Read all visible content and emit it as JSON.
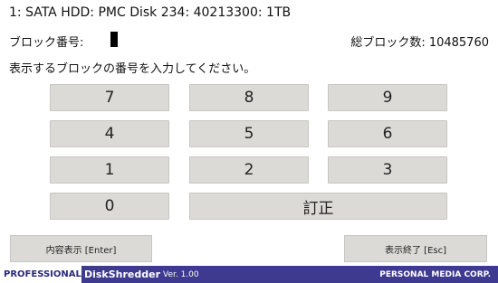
{
  "header": {
    "disk_line": "1:  SATA HDD: PMC Disk 234: 40213300: 1TB"
  },
  "block": {
    "label": "ブロック番号:",
    "total_label": "総ブロック数: 10485760"
  },
  "prompt": "表示するブロックの番号を入力してください。",
  "keypad": {
    "k7": "7",
    "k8": "8",
    "k9": "9",
    "k4": "4",
    "k5": "5",
    "k6": "6",
    "k1": "1",
    "k2": "2",
    "k3": "3",
    "k0": "0",
    "correct": "訂正"
  },
  "buttons": {
    "show_content": "内容表示 [Enter]",
    "end_display": "表示終了 [Esc]"
  },
  "footer": {
    "brand": "PROFESSIONAL",
    "product": "DiskShredder",
    "version": "Ver. 1.00",
    "company": "PERSONAL MEDIA CORP."
  },
  "colors": {
    "key_bg": "#dcdad7",
    "footer_bg": "#3d3a8f"
  }
}
